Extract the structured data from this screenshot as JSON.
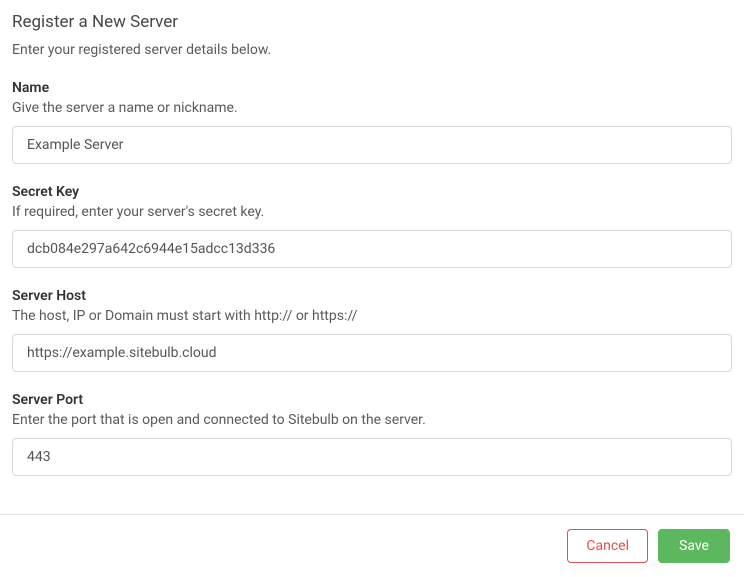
{
  "header": {
    "title": "Register a New Server",
    "subtitle": "Enter your registered server details below."
  },
  "fields": {
    "name": {
      "label": "Name",
      "help": "Give the server a name or nickname.",
      "value": "Example Server"
    },
    "secret_key": {
      "label": "Secret Key",
      "help": "If required, enter your server's secret key.",
      "value": "dcb084e297a642c6944e15adcc13d336"
    },
    "server_host": {
      "label": "Server Host",
      "help": "The host, IP or Domain must start with http:// or https://",
      "value": "https://example.sitebulb.cloud"
    },
    "server_port": {
      "label": "Server Port",
      "help": "Enter the port that is open and connected to Sitebulb on the server.",
      "value": "443"
    }
  },
  "footer": {
    "cancel_label": "Cancel",
    "save_label": "Save"
  }
}
